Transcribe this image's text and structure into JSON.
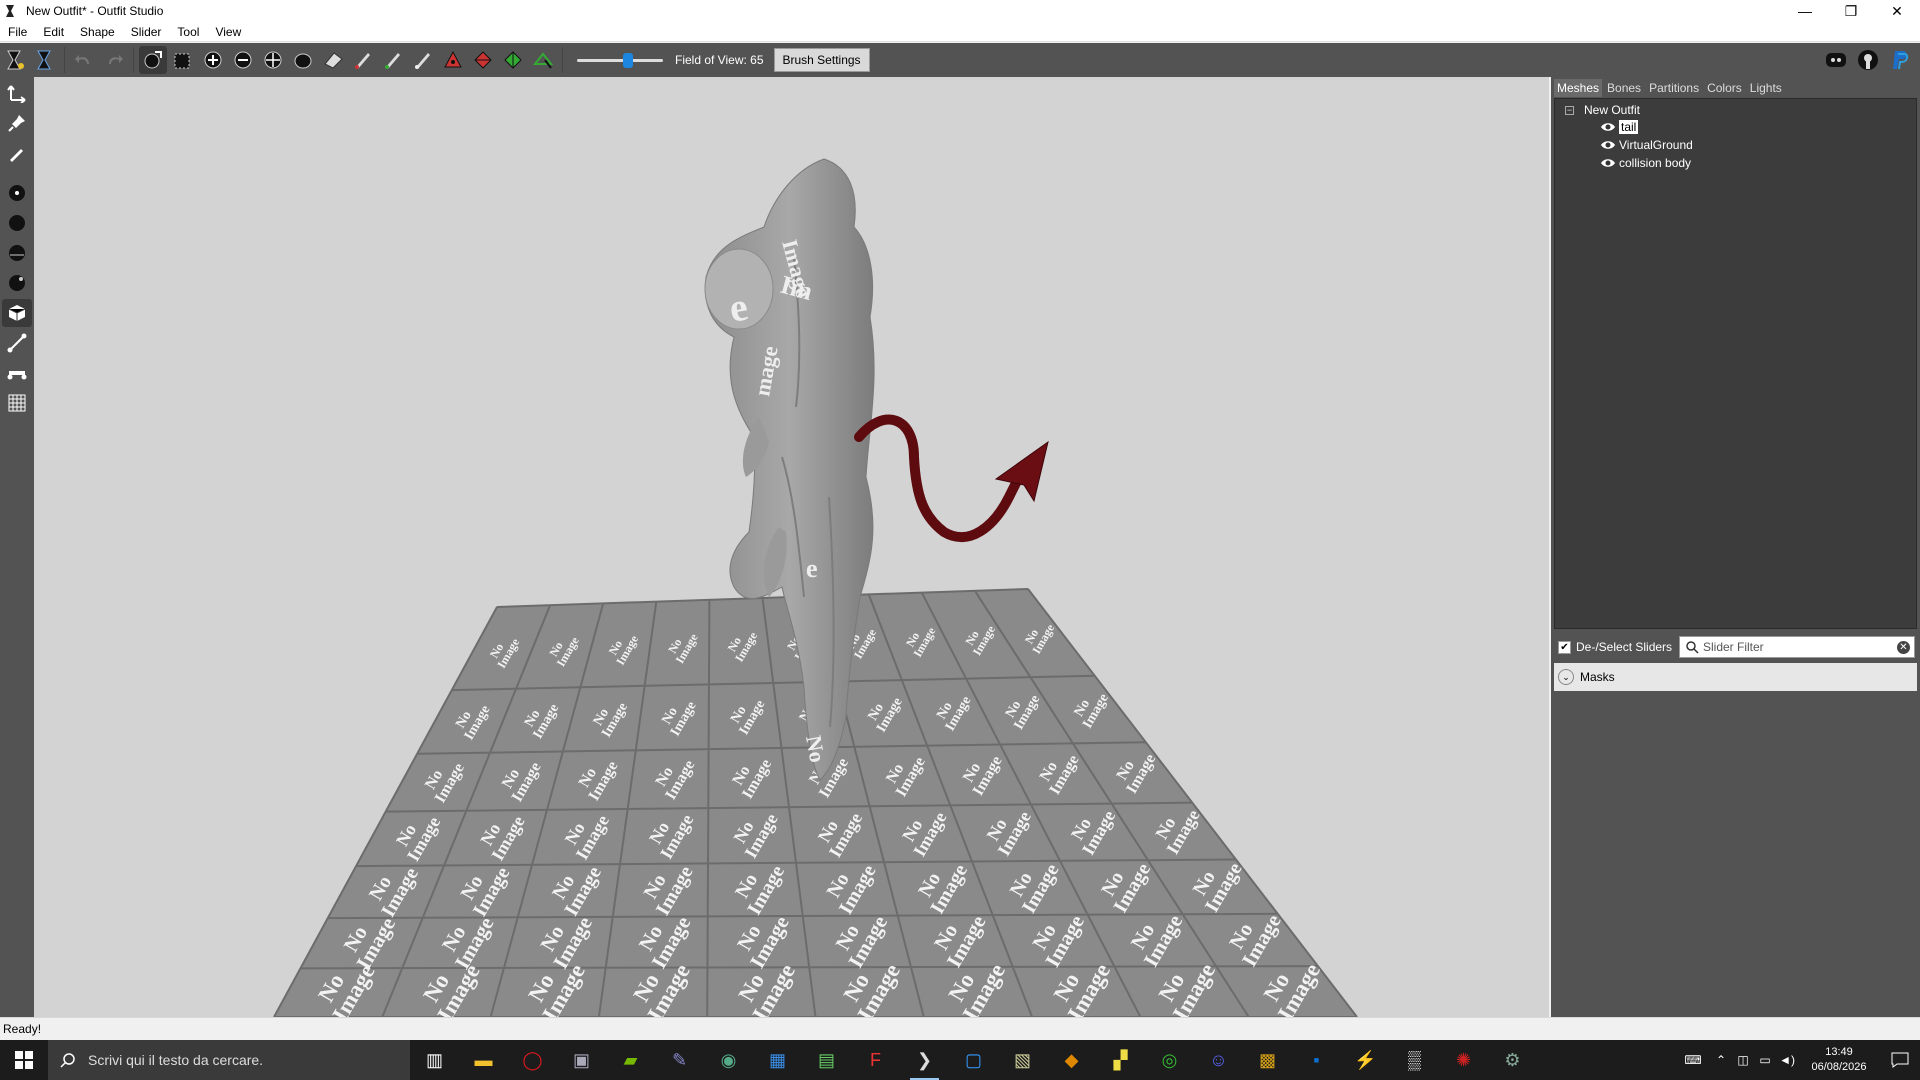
{
  "window": {
    "title": "New Outfit* - Outfit Studio",
    "minimize": "—",
    "restore": "❐",
    "close": "✕"
  },
  "menu": [
    "File",
    "Edit",
    "Shape",
    "Slider",
    "Tool",
    "View"
  ],
  "toolbar": {
    "fov_label": "Field of View: 65",
    "fov_value": 65,
    "brush_settings": "Brush Settings"
  },
  "right_panel": {
    "tabs": [
      "Meshes",
      "Bones",
      "Partitions",
      "Colors",
      "Lights"
    ],
    "active_tab": "Meshes",
    "tree": {
      "root": "New Outfit",
      "items": [
        "tail",
        "VirtualGround",
        "collision body"
      ],
      "selected": "tail"
    },
    "deselect_sliders": "De-/Select Sliders",
    "slider_filter_placeholder": "Slider Filter",
    "masks": "Masks"
  },
  "viewport": {
    "tile_text_1": "No",
    "tile_text_2": "Image"
  },
  "status": "Ready!",
  "taskbar": {
    "search_placeholder": "Scrivi qui il testo da cercare.",
    "time": "13:49",
    "date": "06/08/2026",
    "icons": [
      "task-view-icon",
      "file-explorer-icon",
      "opera-icon",
      "app-icon",
      "nvidia-icon",
      "pen-icon",
      "app2-icon",
      "store-icon",
      "notepad-icon",
      "foxit-icon",
      "outfit-studio-icon",
      "app3-icon",
      "winamp-icon",
      "app4-icon",
      "app5-icon",
      "chrome-icon",
      "discord-icon",
      "folder-icon",
      "photoshop-icon",
      "app6-icon",
      "app7-icon",
      "app8-icon",
      "app9-icon"
    ]
  },
  "colors": {
    "viewport_bg": "#d3d3d3",
    "panel_bg": "#535353",
    "tail_color": "#5e0b10",
    "floor_tile": "#8a8a8a"
  }
}
